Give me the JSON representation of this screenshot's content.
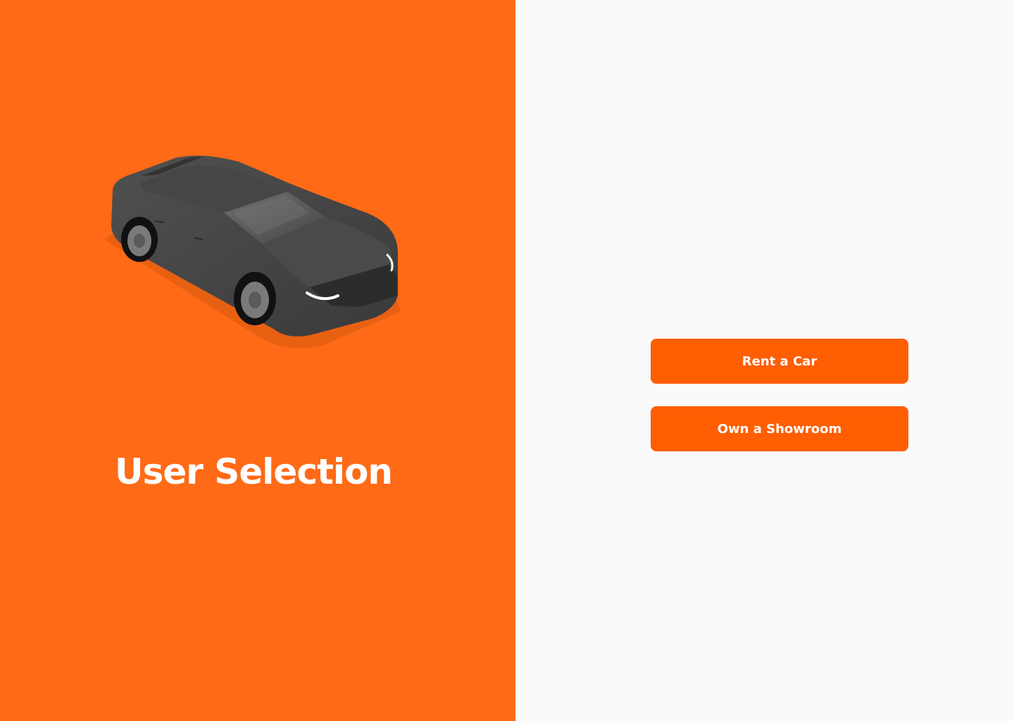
{
  "brand": {
    "accent": "#ff6a17",
    "button_color": "#ff5e03",
    "background": "#fafafa"
  },
  "hero": {
    "title": "User Selection",
    "illustration": "car-icon"
  },
  "actions": {
    "rent_label": "Rent a Car",
    "own_label": "Own a Showroom"
  }
}
